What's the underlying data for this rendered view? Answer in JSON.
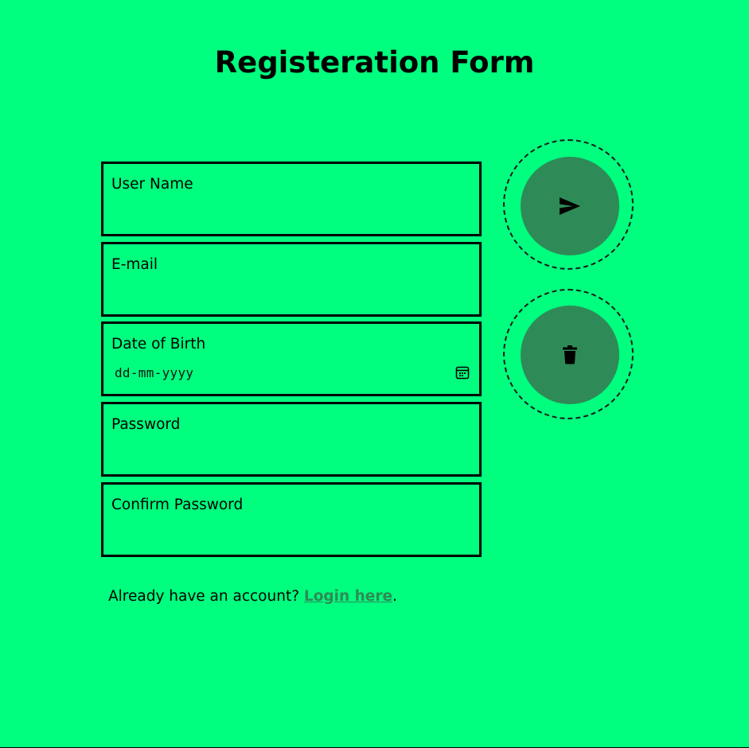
{
  "page": {
    "title": "Registeration Form",
    "background_color": "#00ff7f",
    "accent_color": "#2e8b57"
  },
  "form": {
    "fields": [
      {
        "label": "User Name",
        "value": "",
        "type": "text"
      },
      {
        "label": "E-mail",
        "value": "",
        "type": "email"
      },
      {
        "label": "Date of Birth",
        "value": "",
        "placeholder": "dd-mm-yyyy",
        "type": "date"
      },
      {
        "label": "Password",
        "value": "",
        "type": "password"
      },
      {
        "label": "Confirm Password",
        "value": "",
        "type": "password"
      }
    ]
  },
  "actions": {
    "submit_icon": "send-icon",
    "reset_icon": "trash-icon"
  },
  "footer": {
    "prompt": "Already have an account? ",
    "link_text": "Login here",
    "suffix": "."
  }
}
